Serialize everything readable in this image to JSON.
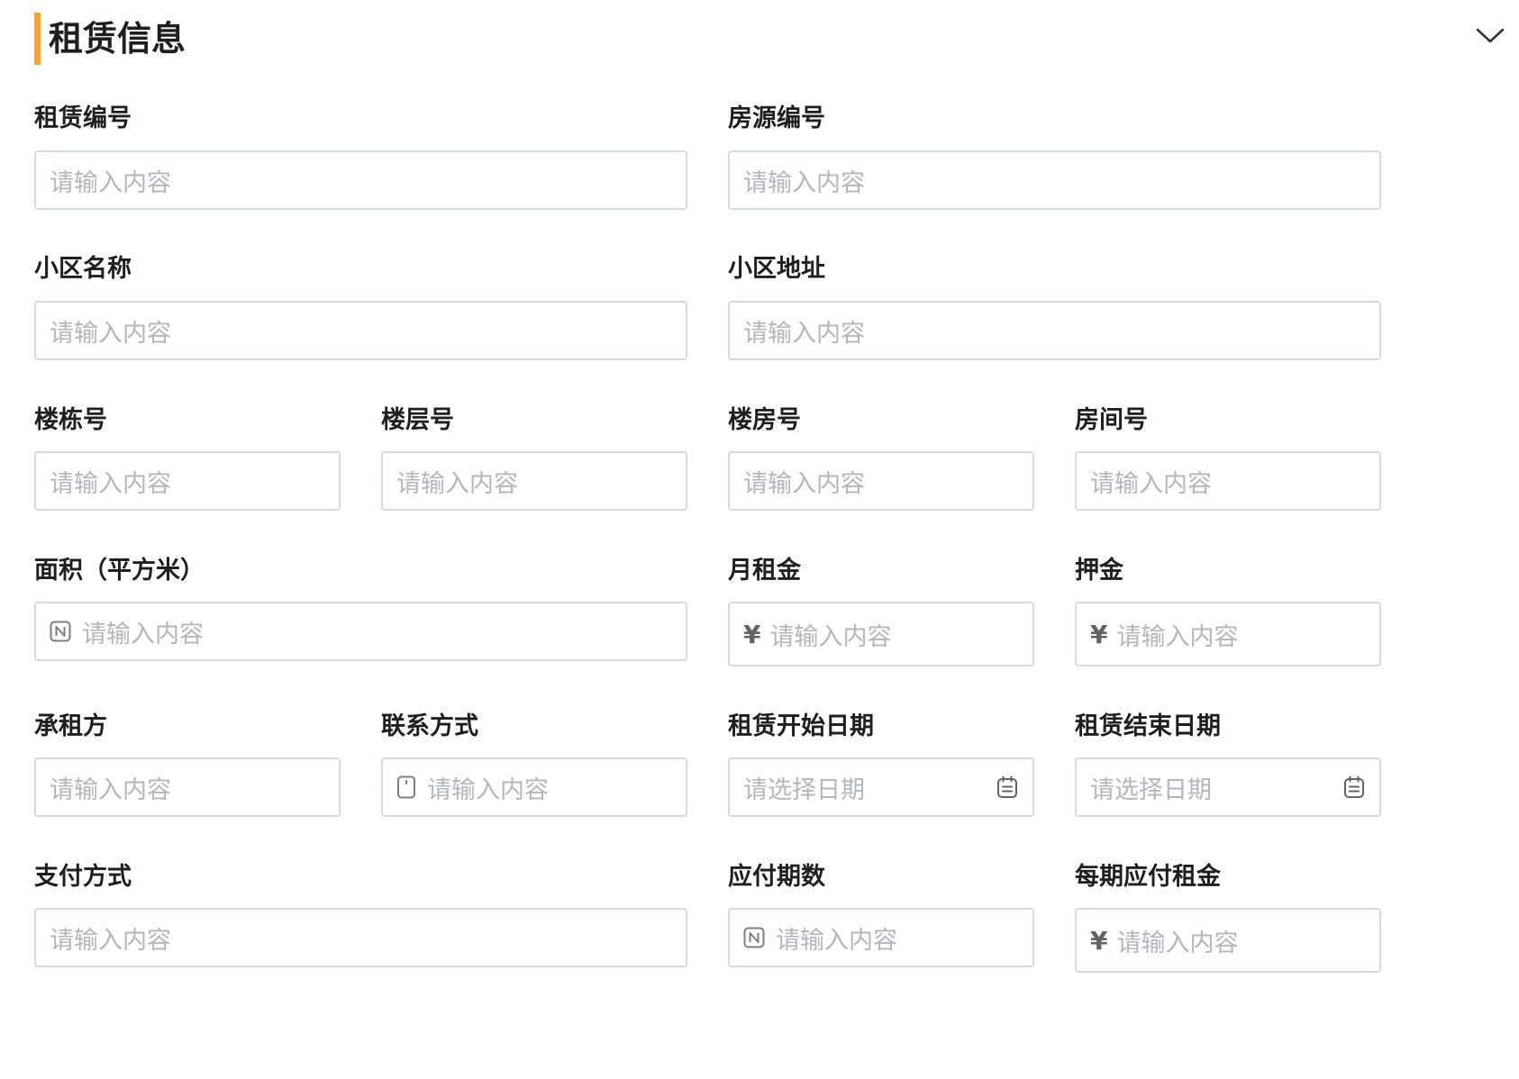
{
  "section": {
    "title": "租赁信息",
    "accent_color": "#f5a33b",
    "toggle_icon": "chevron-down-icon"
  },
  "fields": {
    "lease_no": {
      "label": "租赁编号",
      "placeholder": "请输入内容"
    },
    "listing_no": {
      "label": "房源编号",
      "placeholder": "请输入内容"
    },
    "community_name": {
      "label": "小区名称",
      "placeholder": "请输入内容"
    },
    "community_address": {
      "label": "小区地址",
      "placeholder": "请输入内容"
    },
    "building_no": {
      "label": "楼栋号",
      "placeholder": "请输入内容"
    },
    "floor_no": {
      "label": "楼层号",
      "placeholder": "请输入内容"
    },
    "unit_no": {
      "label": "楼房号",
      "placeholder": "请输入内容"
    },
    "room_no": {
      "label": "房间号",
      "placeholder": "请输入内容"
    },
    "area": {
      "label": "面积（平方米）",
      "placeholder": "请输入内容",
      "icon": "number-icon"
    },
    "monthly_rent": {
      "label": "月租金",
      "placeholder": "请输入内容",
      "prefix": "¥"
    },
    "deposit": {
      "label": "押金",
      "placeholder": "请输入内容",
      "prefix": "¥"
    },
    "tenant": {
      "label": "承租方",
      "placeholder": "请输入内容"
    },
    "contact": {
      "label": "联系方式",
      "placeholder": "请输入内容",
      "icon": "phone-icon"
    },
    "start_date": {
      "label": "租赁开始日期",
      "placeholder": "请选择日期",
      "icon": "calendar-icon"
    },
    "end_date": {
      "label": "租赁结束日期",
      "placeholder": "请选择日期",
      "icon": "calendar-icon"
    },
    "payment_method": {
      "label": "支付方式",
      "placeholder": "请输入内容"
    },
    "installments": {
      "label": "应付期数",
      "placeholder": "请输入内容",
      "icon": "number-icon"
    },
    "rent_per_period": {
      "label": "每期应付租金",
      "placeholder": "请输入内容",
      "prefix": "¥"
    }
  },
  "colors": {
    "input_border": "#d6dbe3",
    "placeholder_text": "#b2b7bf",
    "label_text": "#1f1f1f"
  }
}
